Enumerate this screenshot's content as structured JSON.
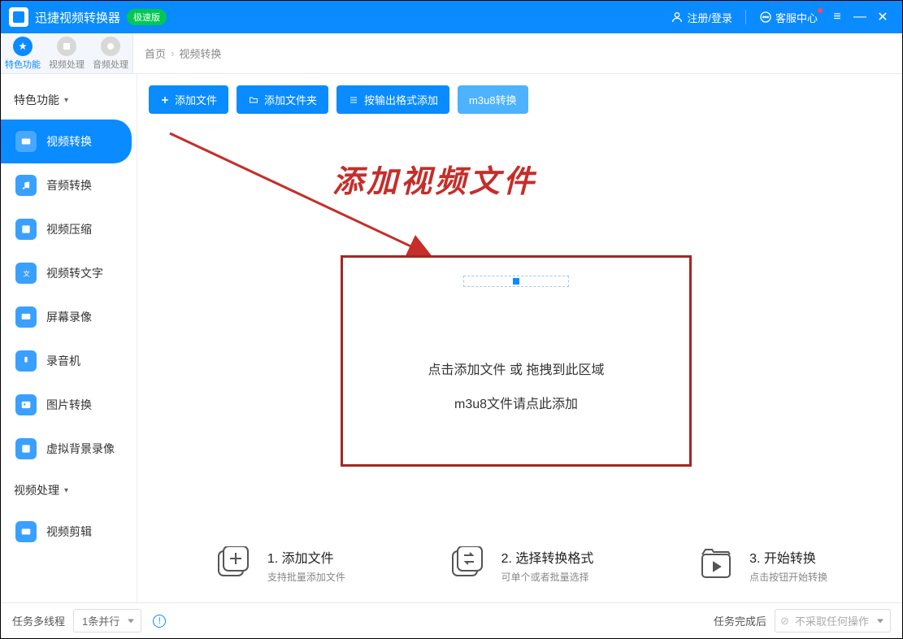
{
  "titlebar": {
    "app_name": "迅捷视频转换器",
    "badge": "极速版",
    "register_login": "注册/登录",
    "support": "客服中心"
  },
  "top_tabs": [
    {
      "label": "特色功能"
    },
    {
      "label": "视频处理"
    },
    {
      "label": "音频处理"
    }
  ],
  "breadcrumb": {
    "home": "首页",
    "current": "视频转换"
  },
  "sidebar": {
    "section1": "特色功能",
    "section2": "视频处理",
    "items": [
      {
        "label": "视频转换"
      },
      {
        "label": "音频转换"
      },
      {
        "label": "视频压缩"
      },
      {
        "label": "视频转文字"
      },
      {
        "label": "屏幕录像"
      },
      {
        "label": "录音机"
      },
      {
        "label": "图片转换"
      },
      {
        "label": "虚拟背景录像"
      }
    ],
    "items2": [
      {
        "label": "视频剪辑"
      }
    ]
  },
  "toolbar": {
    "add_file": "添加文件",
    "add_folder": "添加文件夹",
    "by_output_format": "按输出格式添加",
    "m3u8": "m3u8转换"
  },
  "annotation": {
    "title": "添加视频文件"
  },
  "dropzone": {
    "line1": "点击添加文件 或 拖拽到此区域",
    "line2": "m3u8文件请点此添加"
  },
  "steps": [
    {
      "title": "1. 添加文件",
      "sub": "支持批量添加文件"
    },
    {
      "title": "2. 选择转换格式",
      "sub": "可单个或者批量选择"
    },
    {
      "title": "3. 开始转换",
      "sub": "点击按钮开始转换"
    }
  ],
  "footer": {
    "multithread_label": "任务多线程",
    "multithread_value": "1条并行",
    "after_done_label": "任务完成后",
    "after_done_value": "不采取任何操作"
  }
}
